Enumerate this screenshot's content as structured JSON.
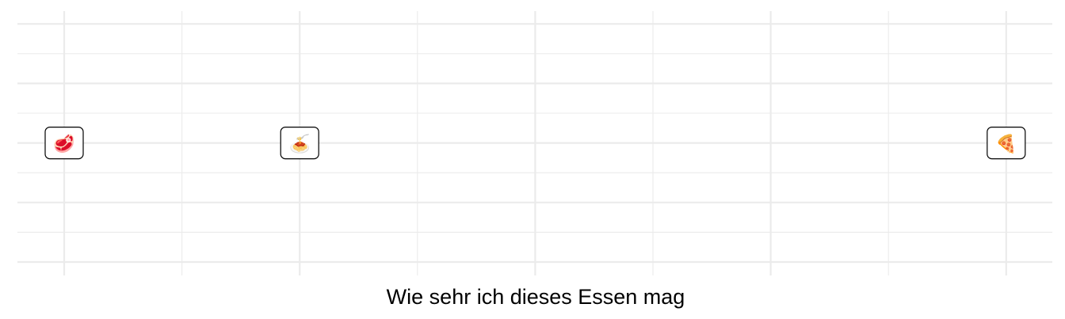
{
  "chart_data": {
    "type": "scatter",
    "xlabel": "Wie sehr ich dieses Essen mag",
    "ylabel": "",
    "title": "",
    "xlim": [
      0,
      9
    ],
    "ylim": [
      0,
      8
    ],
    "x_major_ticks": [
      0,
      2,
      4,
      6,
      8
    ],
    "x_minor_ticks": [
      1,
      3,
      5,
      7
    ],
    "y_major_ticks": [
      0,
      2,
      4,
      6,
      8
    ],
    "y_minor_ticks": [
      1,
      3,
      5,
      7
    ],
    "tick_labels_visible": false,
    "grid": true,
    "points": [
      {
        "x": 0,
        "y": 4,
        "label": "🥩",
        "icon": "meat-steak-icon"
      },
      {
        "x": 2,
        "y": 4,
        "label": "🍝",
        "icon": "spaghetti-icon"
      },
      {
        "x": 8,
        "y": 4,
        "label": "🍕",
        "icon": "pizza-slice-icon"
      }
    ]
  }
}
